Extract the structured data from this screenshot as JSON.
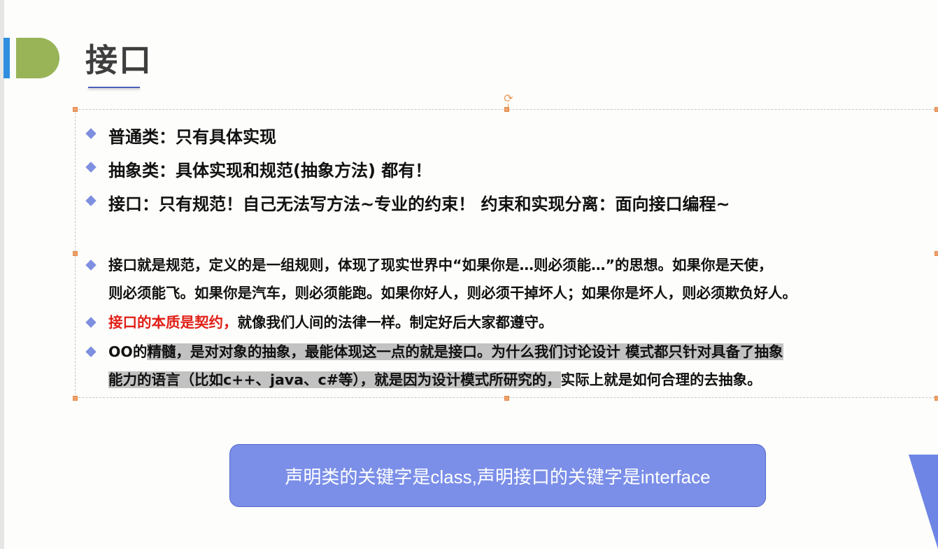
{
  "slide": {
    "title": "接口",
    "bullets": [
      {
        "text": "普通类：只有具体实现"
      },
      {
        "text": "抽象类：具体实现和规范(抽象方法) 都有！"
      },
      {
        "text": "接口：只有规范！自己无法写方法~专业的约束！ 约束和实现分离：面向接口编程~"
      }
    ],
    "details": {
      "p1_line1": "接口就是规范，定义的是一组规则，体现了现实世界中“如果你是…则必须能…”的思想。如果你是天使，",
      "p1_line2": "则必须能飞。如果你是汽车，则必须能跑。如果你好人，则必须干掉坏人；如果你是坏人，则必须欺负好人。",
      "p2_red": "接口的本质是契约，",
      "p2_rest": "就像我们人间的法律一样。制定好后大家都遵守。",
      "p3_line1_plain": "OO的",
      "p3_line1_hl": "精髓，是对对象的抽象，最能体现这一点的就是接口。为什么我们讨论设计 模式都只针对具备了抽象",
      "p3_line2_hl": "能力的语言（比如c++、java、c#等），就是因为设计模式所研究的，",
      "p3_line2_plain": "实际上就是如何合理的去抽象。"
    },
    "callout": "声明类的关键字是class,声明接口的关键字是interface"
  },
  "colors": {
    "accent_blue": "#2f8ee0",
    "accent_green": "#98b457",
    "bullet_diamond": "#7e8fe0",
    "callout_bg": "#7b8fe8",
    "emphasis_red": "#e11f17",
    "highlight_gray": "#c2c2c2"
  },
  "icons": {
    "rotate_handle": "rotate-icon"
  }
}
